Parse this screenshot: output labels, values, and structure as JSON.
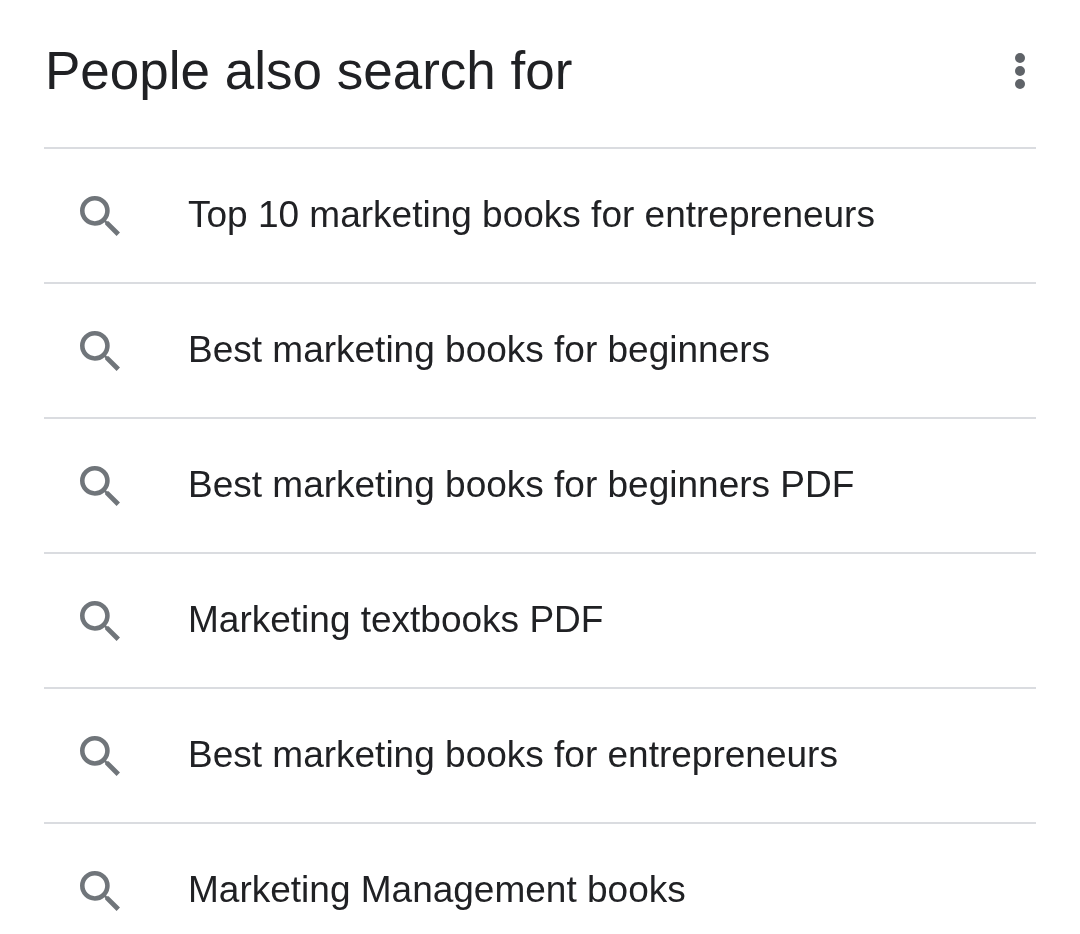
{
  "header": {
    "title": "People also search for"
  },
  "suggestions": [
    {
      "text": "Top 10 marketing books for entrepreneurs"
    },
    {
      "text": "Best marketing books for beginners"
    },
    {
      "text": "Best marketing books for beginners PDF"
    },
    {
      "text": "Marketing textbooks PDF"
    },
    {
      "text": "Best marketing books for entrepreneurs"
    },
    {
      "text": "Marketing Management books"
    }
  ]
}
